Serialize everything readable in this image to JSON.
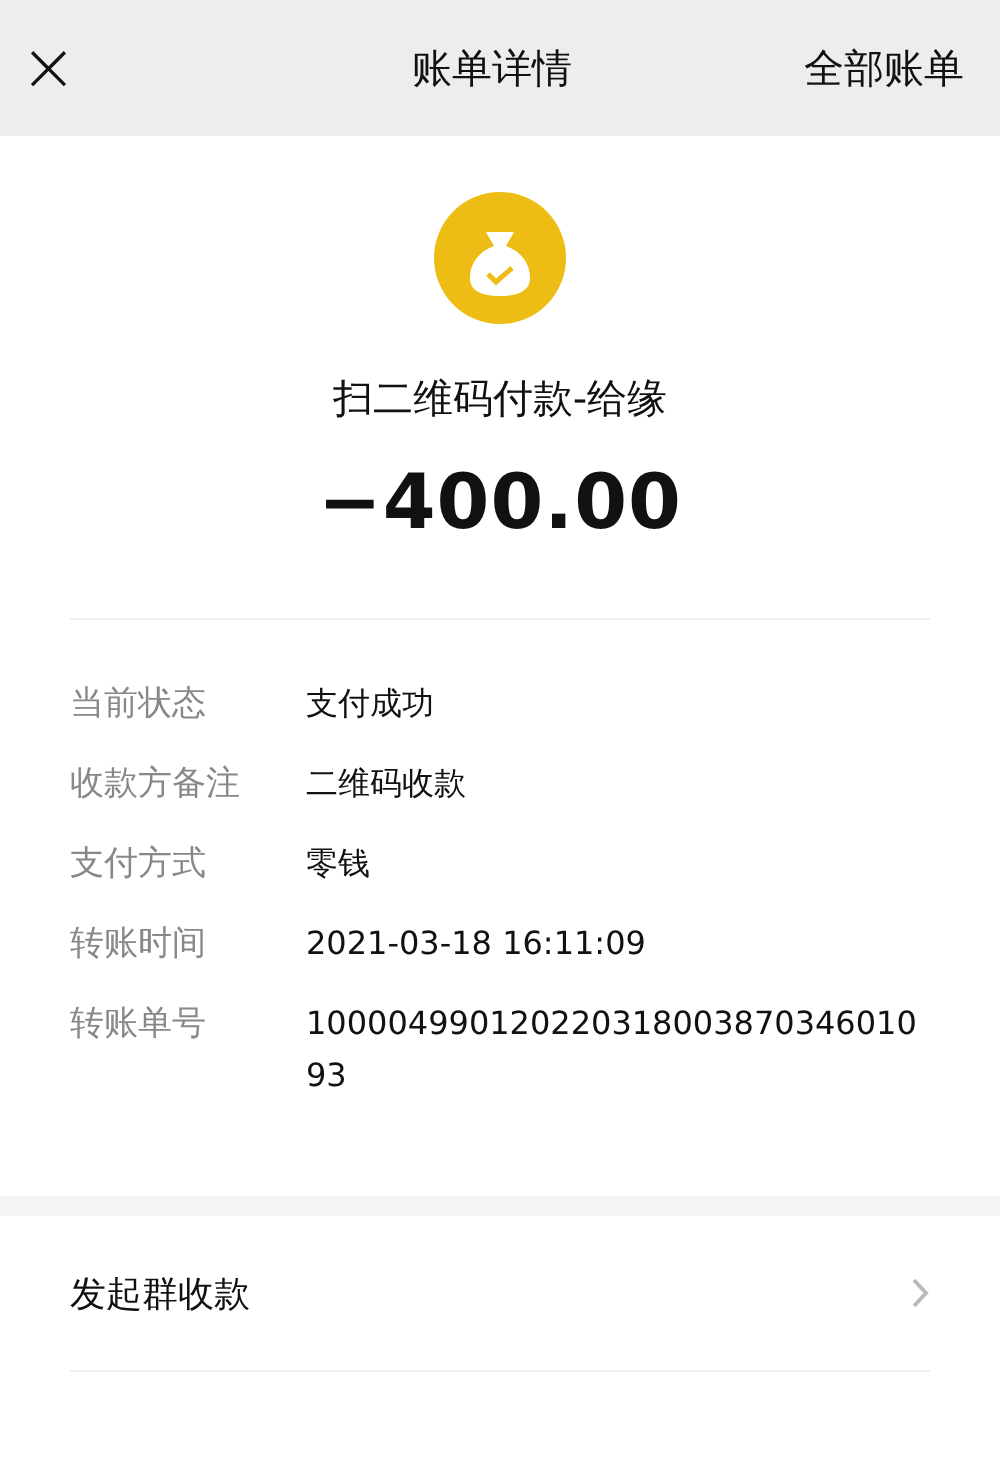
{
  "header": {
    "close": "×",
    "title": "账单详情",
    "action": "全部账单"
  },
  "summary": {
    "title": "扫二维码付款-给缘",
    "amount": "−400.00"
  },
  "details": [
    {
      "label": "当前状态",
      "value": "支付成功"
    },
    {
      "label": "收款方备注",
      "value": "二维码收款"
    },
    {
      "label": "支付方式",
      "value": "零钱"
    },
    {
      "label": "转账时间",
      "value": "2021-03-18 16:11:09"
    },
    {
      "label": "转账单号",
      "value": "10000499012022031800387034601093"
    }
  ],
  "actions": [
    {
      "label": "发起群收款"
    }
  ]
}
